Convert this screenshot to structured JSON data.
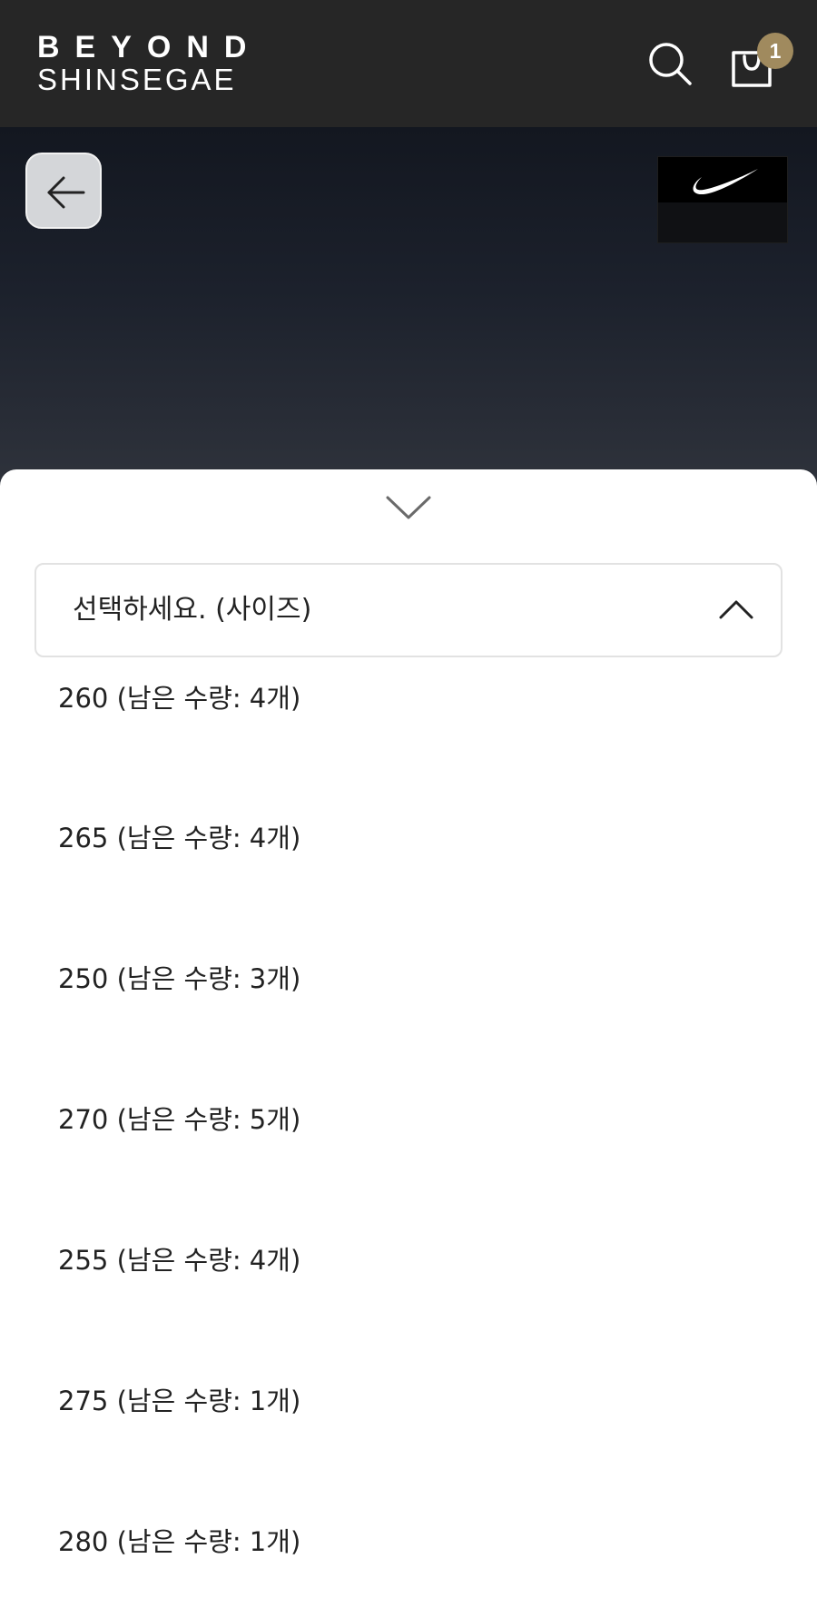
{
  "header": {
    "logo_line1": "BEYOND",
    "logo_line2": "SHINSEGAE",
    "search_icon": "search-icon",
    "cart_icon": "shopping-bag-icon",
    "cart_count": "1",
    "colors": {
      "background": "#262626",
      "badge": "#a08a5e"
    }
  },
  "hero": {
    "back_icon": "arrow-left-icon",
    "brand_logo": "nike-swoosh-logo"
  },
  "sheet": {
    "collapse_icon": "chevron-down-icon",
    "select": {
      "placeholder": "선택하세요. (사이즈)",
      "chevron_icon": "chevron-up-icon",
      "expanded": true
    },
    "options": [
      "260 (남은 수량: 4개)",
      "265 (남은 수량: 4개)",
      "250 (남은 수량: 3개)",
      "270 (남은 수량: 5개)",
      "255 (남은 수량: 4개)",
      "275 (남은 수량: 1개)",
      "280 (남은 수량: 1개)"
    ]
  }
}
